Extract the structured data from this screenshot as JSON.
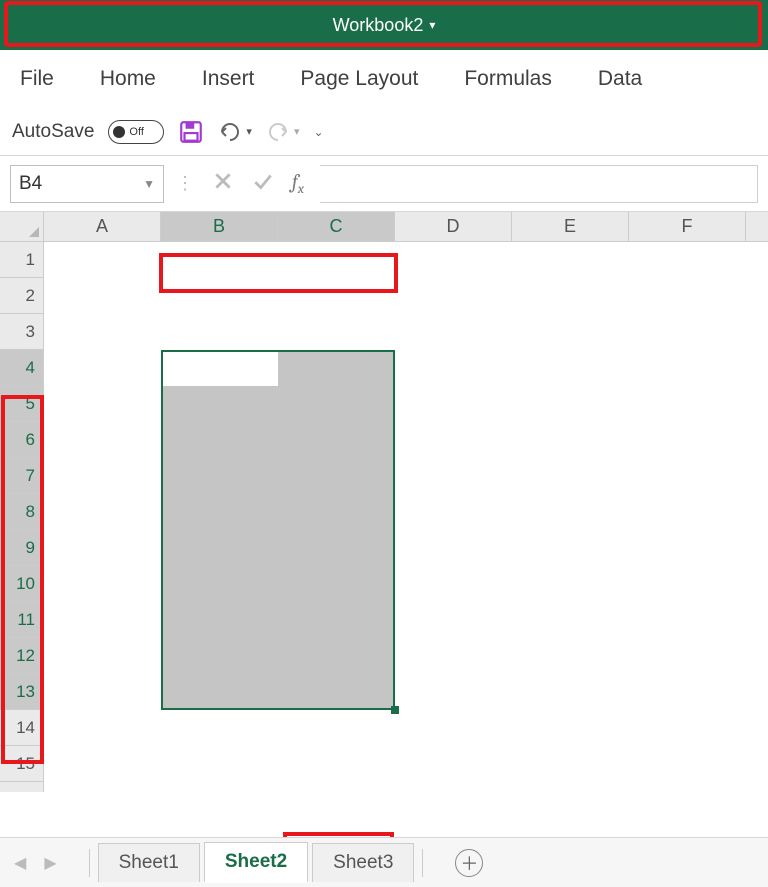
{
  "title": "Workbook2",
  "menu": [
    "File",
    "Home",
    "Insert",
    "Page Layout",
    "Formulas",
    "Data"
  ],
  "qat": {
    "autosave_label": "AutoSave",
    "autosave_state": "Off"
  },
  "namebox": "B4",
  "formula": "",
  "columns": [
    "A",
    "B",
    "C",
    "D",
    "E",
    "F"
  ],
  "selected_columns": [
    "B",
    "C"
  ],
  "rows": [
    1,
    2,
    3,
    4,
    5,
    6,
    7,
    8,
    9,
    10,
    11,
    12,
    13,
    14,
    15
  ],
  "selected_rows": [
    4,
    5,
    6,
    7,
    8,
    9,
    10,
    11,
    12,
    13
  ],
  "active_cell": "B4",
  "selection_range": "B4:C13",
  "sheets": [
    "Sheet1",
    "Sheet2",
    "Sheet3"
  ],
  "active_sheet": "Sheet2",
  "icons": {
    "save": "save-icon",
    "undo": "undo-icon",
    "redo": "redo-icon",
    "cancel": "cancel-icon",
    "confirm": "check-icon",
    "fx": "fx-icon",
    "add": "plus-icon"
  }
}
